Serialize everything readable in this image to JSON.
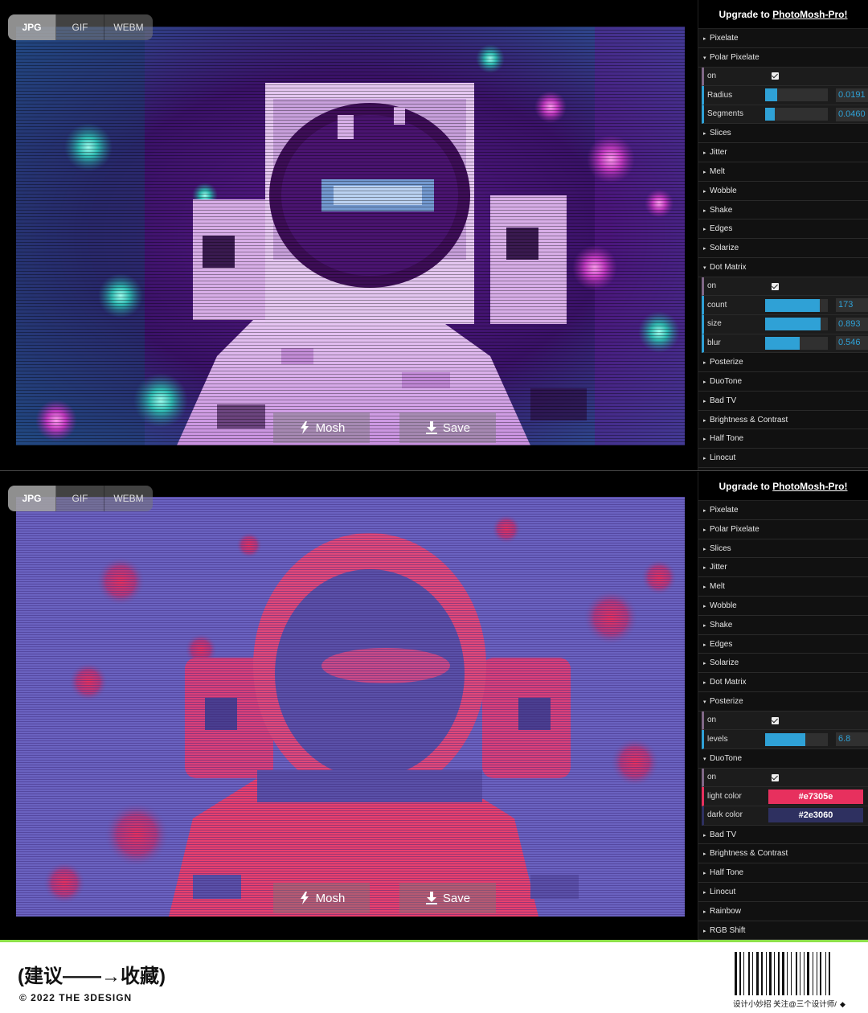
{
  "panel1": {
    "format_tabs": [
      {
        "label": "JPG",
        "active": true
      },
      {
        "label": "GIF",
        "active": false
      },
      {
        "label": "WEBM",
        "active": false
      }
    ],
    "mosh_label": "Mosh",
    "save_label": "Save",
    "upgrade_prefix": "Upgrade to ",
    "upgrade_link": "PhotoMosh-Pro!",
    "polar_pixelate": {
      "on_label": "on",
      "on_checked": true,
      "radius_label": "Radius",
      "radius_value": "0.0191",
      "radius_fraction": 0.19,
      "segments_label": "Segments",
      "segments_value": "0.0460",
      "segments_fraction": 0.16
    },
    "dot_matrix": {
      "on_label": "on",
      "on_checked": true,
      "count_label": "count",
      "count_value": "173",
      "count_fraction": 0.87,
      "size_label": "size",
      "size_value": "0.893",
      "size_fraction": 0.89,
      "blur_label": "blur",
      "blur_value": "0.546",
      "blur_fraction": 0.55
    },
    "effects": [
      "Pixelate",
      "Polar Pixelate",
      "Slices",
      "Jitter",
      "Melt",
      "Wobble",
      "Shake",
      "Edges",
      "Solarize",
      "Dot Matrix",
      "Posterize",
      "DuoTone",
      "Bad TV",
      "Brightness & Contrast",
      "Half Tone",
      "Linocut"
    ]
  },
  "panel2": {
    "format_tabs": [
      {
        "label": "JPG",
        "active": true
      },
      {
        "label": "GIF",
        "active": false
      },
      {
        "label": "WEBM",
        "active": false
      }
    ],
    "mosh_label": "Mosh",
    "save_label": "Save",
    "upgrade_prefix": "Upgrade to ",
    "upgrade_link": "PhotoMosh-Pro!",
    "posterize": {
      "on_label": "on",
      "on_checked": true,
      "levels_label": "levels",
      "levels_value": "6.8",
      "levels_fraction": 0.64
    },
    "duotone": {
      "on_label": "on",
      "on_checked": true,
      "light_label": "light color",
      "light_value": "#e7305e",
      "dark_label": "dark color",
      "dark_value": "#2e3060"
    },
    "effects": [
      "Pixelate",
      "Polar Pixelate",
      "Slices",
      "Jitter",
      "Melt",
      "Wobble",
      "Shake",
      "Edges",
      "Solarize",
      "Dot Matrix",
      "Posterize",
      "DuoTone",
      "Bad TV",
      "Brightness & Contrast",
      "Half Tone",
      "Linocut",
      "Rainbow",
      "RGB Shift"
    ]
  },
  "footer": {
    "cta": "(建议——→收藏)",
    "copyright": "© 2022 THE 3DESIGN",
    "note": "设计小妙招  关注@三个设计师/",
    "note_mark": "◆"
  },
  "colors": {
    "accent_blue": "#2fa1d6",
    "duotone_light": "#e7305e",
    "duotone_dark": "#2e3060",
    "footer_rule": "#8de04a"
  }
}
